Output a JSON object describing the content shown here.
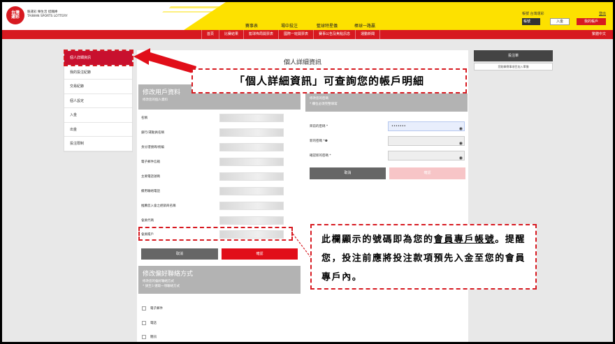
{
  "header": {
    "logo_text": "台灣\n運彩",
    "logo_sub_line1": "競運彩 樂生活 挺職棒",
    "logo_sub_line2": "TAIWAN SPORTS LOTTERY",
    "nav": [
      "賽事表",
      "場中投注",
      "籃球特星儀",
      "棒球一路贏"
    ],
    "account": {
      "username_label": "帳號 台灣運彩",
      "forgot": "登出",
      "select": "帳號",
      "login": "入金",
      "my_account": "我的帳戶"
    }
  },
  "rednav": {
    "items": [
      "首頁",
      "比賽結果",
      "籃球佈局開票表",
      "國際一班開票表",
      "賽事公告及焦點訊息",
      "運動新聞"
    ],
    "lang": "繁體中文"
  },
  "sidebar": {
    "items": [
      {
        "label": "個人詳細資訊",
        "active": true
      },
      {
        "label": "我的投注紀錄",
        "active": false
      },
      {
        "label": "交易紀錄",
        "active": false
      },
      {
        "label": "個人設定",
        "active": false
      },
      {
        "label": "入金",
        "active": false
      },
      {
        "label": "出金",
        "active": false
      },
      {
        "label": "投注限制",
        "active": false
      }
    ]
  },
  "main": {
    "title": "個人詳細資訊",
    "edit_section": {
      "heading": "修改用戶資料",
      "subheading": "修改您的個人資料",
      "fields": [
        "名稱",
        "銀行/運動員名稱",
        "身分證號碼/統編",
        "電子郵件信箱",
        "主要電話號碼",
        "備用聯絡電話",
        "推薦您入會之經銷商名稱",
        "會員代碼",
        "會員帳戶"
      ],
      "cancel": "取消",
      "submit": "確認"
    },
    "password_section": {
      "heading": "修改您的密碼",
      "subheading": "* 欄位必須完整填寫",
      "fields": [
        {
          "label": "目前的密碼 *",
          "value": "•••••••",
          "focused": true
        },
        {
          "label": "新的密碼 *❶",
          "value": "",
          "focused": false
        },
        {
          "label": "確認新的密碼 *",
          "value": "",
          "focused": false
        }
      ],
      "cancel": "取消",
      "submit": "確認"
    },
    "pref_section": {
      "heading": "修改偏好聯絡方式",
      "subheading": "修改您的偏好聯絡方式",
      "note": "* 請至少選取一項聯絡方式",
      "options": [
        "電子郵件",
        "電話",
        "簡訊"
      ]
    }
  },
  "right": {
    "bar": "投注單",
    "link": "您點擊賽事項目加入單獨"
  },
  "annotations": {
    "callout1": "「個人詳細資訊」可查詢您的帳戶明細",
    "callout2_part1": "此欄顯示的號碼即為您的",
    "callout2_underline": "會員專戶帳號",
    "callout2_part2": "。提醒您，投注前應將投注款項預先入金至您的會員專戶內。"
  },
  "colors": {
    "brand_red": "#d71920",
    "brand_yellow": "#fde100",
    "section_gray": "#b3b3b3"
  }
}
